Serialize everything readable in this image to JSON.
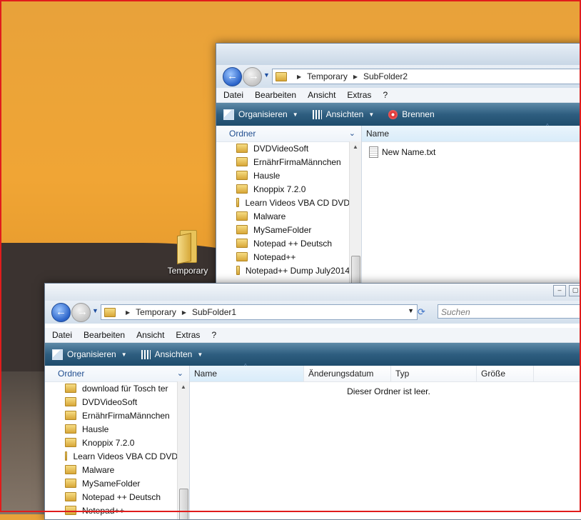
{
  "desktop": {
    "icon_label": "Temporary"
  },
  "back_window": {
    "path": [
      "Temporary",
      "SubFolder2"
    ],
    "menu": [
      "Datei",
      "Bearbeiten",
      "Ansicht",
      "Extras",
      "?"
    ],
    "toolbar": {
      "organize": "Organisieren",
      "views": "Ansichten",
      "burn": "Brennen"
    },
    "nav_header": "Ordner",
    "tree": [
      "DVDVideoSoft",
      "ErnährFirmaMännchen",
      "Hausle",
      "Knoppix 7.2.0",
      "Learn Videos VBA CD DVD",
      "Malware",
      "MySameFolder",
      "Notepad ++ Deutsch",
      "Notepad++",
      "Notepad++ Dump July2014"
    ],
    "columns": [
      "Name"
    ],
    "files": [
      "New Name.txt"
    ]
  },
  "front_window": {
    "path": [
      "Temporary",
      "SubFolder1"
    ],
    "search_placeholder": "Suchen",
    "menu": [
      "Datei",
      "Bearbeiten",
      "Ansicht",
      "Extras",
      "?"
    ],
    "toolbar": {
      "organize": "Organisieren",
      "views": "Ansichten"
    },
    "nav_header": "Ordner",
    "tree": [
      "download für Tosch ter",
      "DVDVideoSoft",
      "ErnährFirmaMännchen",
      "Hausle",
      "Knoppix 7.2.0",
      "Learn Videos VBA CD DVD",
      "Malware",
      "MySameFolder",
      "Notepad ++ Deutsch",
      "Notepad++"
    ],
    "columns": [
      "Name",
      "Änderungsdatum",
      "Typ",
      "Größe"
    ],
    "empty_message": "Dieser Ordner ist leer."
  }
}
